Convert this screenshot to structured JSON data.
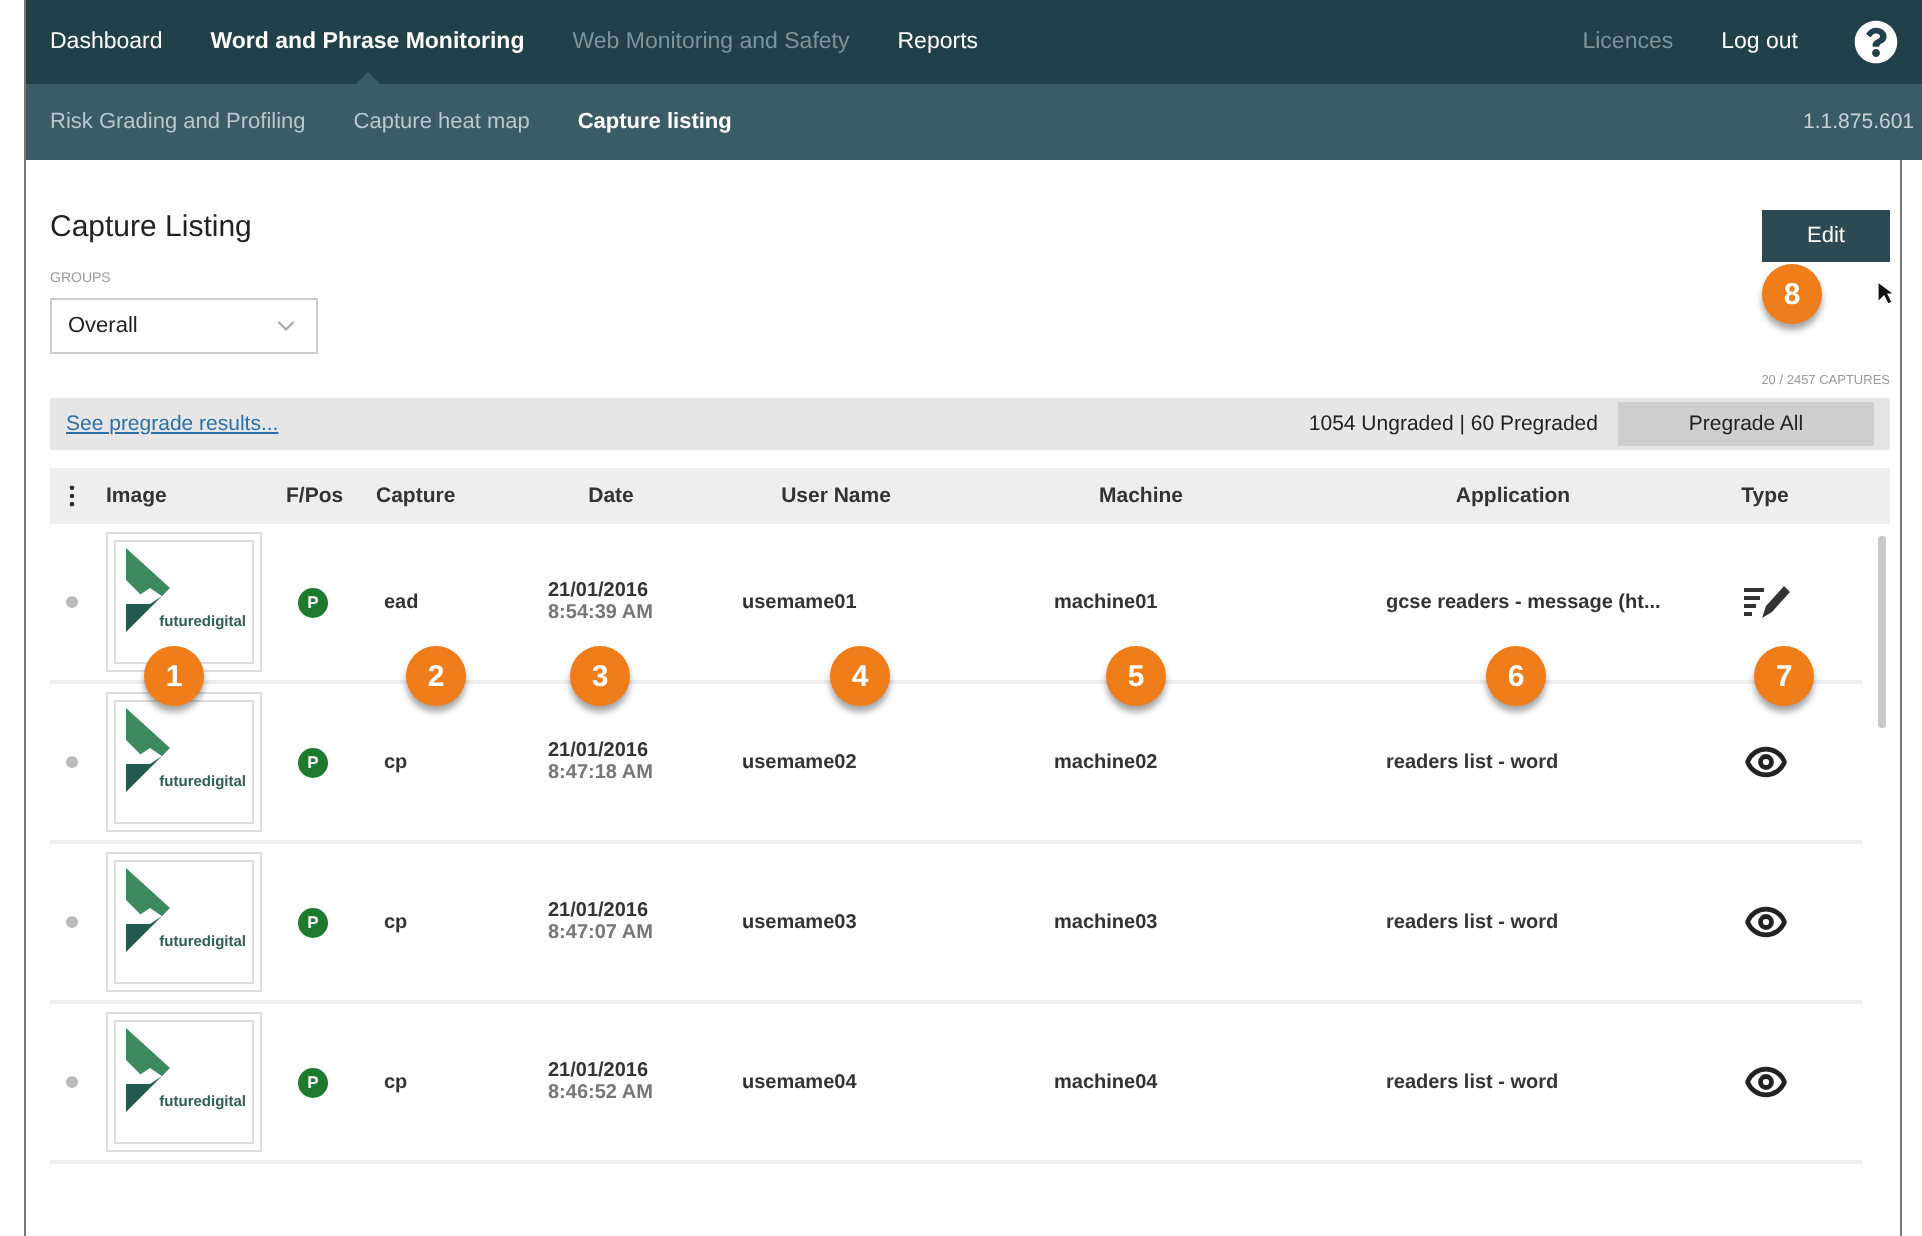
{
  "top_nav": {
    "items": [
      {
        "label": "Dashboard",
        "selected": false,
        "disabled": false
      },
      {
        "label": "Word and Phrase Monitoring",
        "selected": true,
        "disabled": false
      },
      {
        "label": "Web Monitoring and Safety",
        "selected": false,
        "disabled": true
      },
      {
        "label": "Reports",
        "selected": false,
        "disabled": false
      }
    ],
    "right_items": [
      {
        "label": "Licences",
        "disabled": true
      },
      {
        "label": "Log out",
        "disabled": false
      }
    ]
  },
  "sub_nav": {
    "items": [
      {
        "label": "Risk Grading and Profiling",
        "selected": false
      },
      {
        "label": "Capture heat map",
        "selected": false
      },
      {
        "label": "Capture listing",
        "selected": true
      }
    ],
    "version": "1.1.875.601"
  },
  "page": {
    "title": "Capture Listing",
    "edit_button": "Edit",
    "edit_callout": "8",
    "groups": {
      "label": "GROUPS",
      "value": "Overall"
    },
    "capture_count": "20 / 2457 CAPTURES"
  },
  "summary_bar": {
    "link": "See pregrade results...",
    "counts": "1054 Ungraded | 60 Pregraded",
    "button": "Pregrade All"
  },
  "table": {
    "columns": [
      "Image",
      "F/Pos",
      "Capture",
      "Date",
      "User Name",
      "Machine",
      "Application",
      "Type"
    ],
    "callouts": [
      "1",
      "2",
      "3",
      "4",
      "5",
      "6",
      "7"
    ],
    "rows": [
      {
        "logo_text": "**future**digital",
        "fpos": "P",
        "capture": "ead",
        "date": "21/01/2016",
        "time": "8:54:39 AM",
        "user": "usemame01",
        "machine": "machine01",
        "application": "gcse readers - message (ht...",
        "kind": "edit"
      },
      {
        "logo_text": "**future**digital",
        "fpos": "P",
        "capture": "cp",
        "date": "21/01/2016",
        "time": "8:47:18 AM",
        "user": "usemame02",
        "machine": "machine02",
        "application": "readers list - word",
        "kind": "view"
      },
      {
        "logo_text": "**future**digital",
        "fpos": "P",
        "capture": "cp",
        "date": "21/01/2016",
        "time": "8:47:07 AM",
        "user": "usemame03",
        "machine": "machine03",
        "application": "readers list - word",
        "kind": "view"
      },
      {
        "logo_text": "**future**digital",
        "fpos": "P",
        "capture": "cp",
        "date": "21/01/2016",
        "time": "8:46:52 AM",
        "user": "usemame04",
        "machine": "machine04",
        "application": "readers list - word",
        "kind": "view"
      }
    ]
  }
}
